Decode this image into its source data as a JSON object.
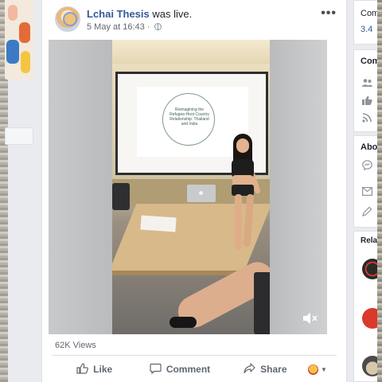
{
  "post": {
    "author": "Lchai Thesis",
    "action": " was live.",
    "timestamp": "5 May at 16:43",
    "separator": "·",
    "more_icon": "more-options-icon",
    "video": {
      "slide_title": "Reimagining the Refugee-Host Country Relationship: Thailand and India",
      "mute_icon": "volume-muted-icon"
    },
    "views": "62K Views",
    "actions": {
      "like": "Like",
      "comment": "Comment",
      "share": "Share"
    }
  },
  "right_column": {
    "card1": {
      "title": "Com",
      "stat": "3.4"
    },
    "card2": {
      "title": "Com"
    },
    "card3": {
      "title": "Abo"
    },
    "card4": {
      "title": "Relat"
    }
  },
  "colors": {
    "link": "#365899",
    "background": "#e9ebee",
    "muted_text": "#616770",
    "related_red": "#d93a2b"
  }
}
